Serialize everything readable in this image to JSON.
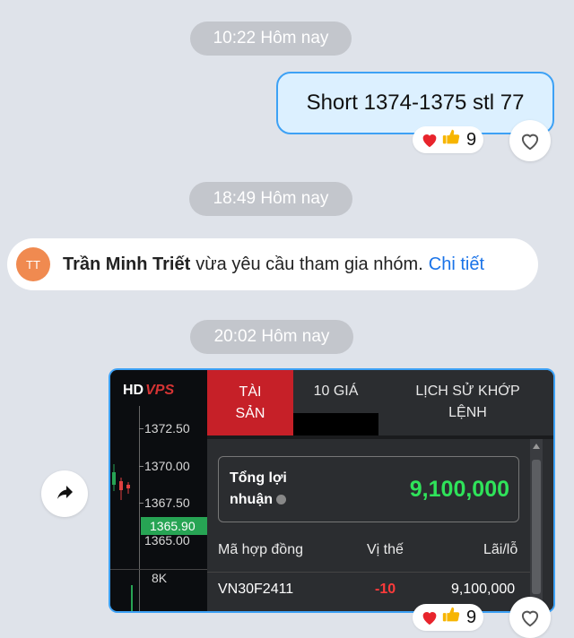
{
  "messages": {
    "time1": "10:22 Hôm nay",
    "outgoing_text": "Short 1374-1375 stl 77",
    "reaction1_count": "9",
    "time2": "18:49 Hôm nay",
    "notice": {
      "avatar_initials": "TT",
      "name": "Trần Minh Triết",
      "text": "vừa yêu cầu tham gia nhóm.",
      "link": "Chi tiết"
    },
    "time3": "20:02 Hôm nay",
    "reaction2_count": "9"
  },
  "screenshot": {
    "logo_hd": "HD",
    "logo_brand": "VPS",
    "prices": [
      "1372.50",
      "1370.00",
      "1367.50",
      "1365.00"
    ],
    "current_price": "1365.90",
    "volume_label": "8K",
    "tabs": [
      "TÀI SẢN",
      "10 GIÁ",
      "LỊCH SỬ KHỚP LỆNH"
    ],
    "tab_active_line1": "TÀI",
    "tab_active_line2": "SẢN",
    "tab3_line1": "LỊCH SỬ KHỚP",
    "tab3_line2": "LỆNH",
    "profit_label_line1": "Tổng lợi",
    "profit_label_line2": "nhuận",
    "profit_value": "9,100,000",
    "table_headers": [
      "Mã hợp đồng",
      "Vị thế",
      "Lãi/lỗ"
    ],
    "table_rows": [
      {
        "contract": "VN30F2411",
        "position": "-10",
        "pnl": "9,100,000"
      }
    ]
  },
  "colors": {
    "background": "#dfe3ea",
    "outgoing_bubble": "#dcf0ff",
    "accent_border": "#3da1f5",
    "profit_green": "#2fe35a",
    "loss_red": "#ff3b3b",
    "vps_red": "#c62028"
  },
  "icons": [
    "heart-icon",
    "thumbs-up-icon",
    "like-outline-icon",
    "share-arrow-icon",
    "info-icon"
  ]
}
